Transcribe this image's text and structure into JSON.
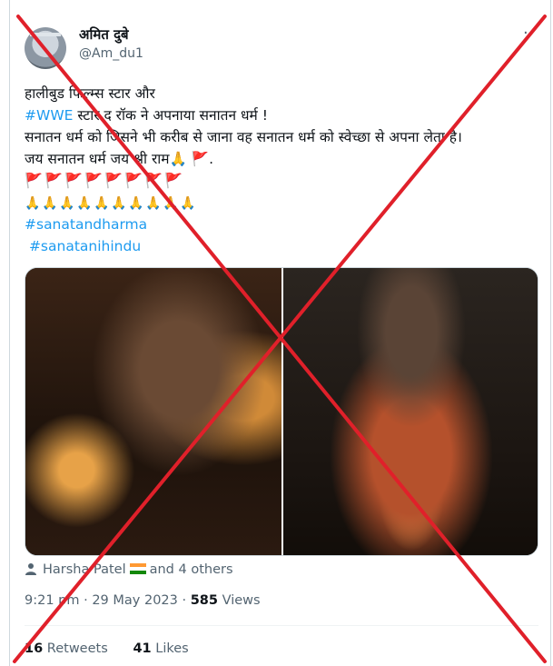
{
  "author": {
    "display_name": "अमित दुबे",
    "handle": "@Am_du1"
  },
  "menu_icon_glyph": "··",
  "tweet": {
    "line1": "हालीबुड फिल्म्स स्टार और",
    "line2_hashtag": "#WWE",
    "line2_rest": "  स्टार द रॉक ने अपनाया सनातन धर्म !",
    "line3": "सनातन धर्म को जिसने भी करीब से जाना वह सनातन धर्म को स्वेच्छा से अपना लेता है।",
    "line4": "जय सनातन धर्म जय श्री राम🙏 🚩.",
    "flag_count": 8,
    "hands_count": 10,
    "hashtag1": "#sanatandharma",
    "hashtag2": "#sanatanihindu"
  },
  "tagged": {
    "person": "Harsha Patel",
    "others": "and 4 others"
  },
  "meta": {
    "time": "9:21 pm",
    "dot": " · ",
    "date": "29 May 2023",
    "views_count": "585",
    "views_label": " Views"
  },
  "stats": {
    "retweets_count": "16",
    "retweets_label": " Retweets",
    "likes_count": "41",
    "likes_label": " Likes"
  },
  "colors": {
    "link": "#1d9bf0",
    "cross": "#e0202a",
    "muted": "#536471"
  },
  "icons": [
    "person-icon",
    "india-flag-icon",
    "red-flag-icon",
    "folded-hands-icon",
    "more-icon"
  ]
}
